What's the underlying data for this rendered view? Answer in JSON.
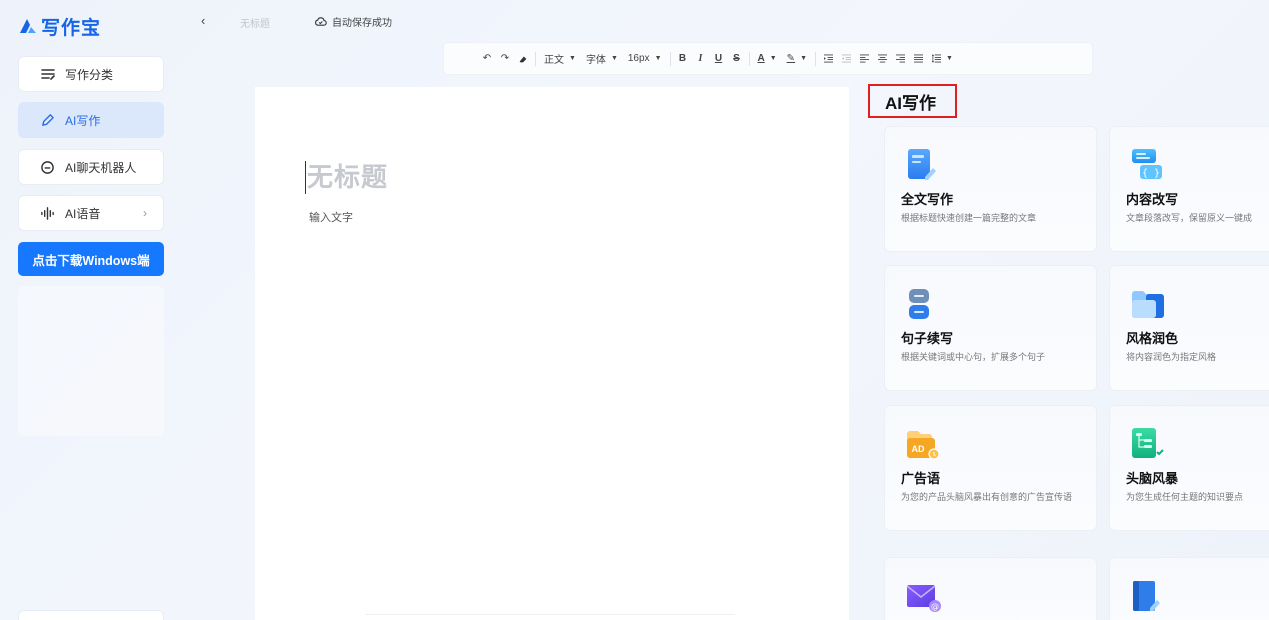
{
  "app": {
    "name": "写作宝"
  },
  "sidebar": {
    "items": [
      {
        "label": "写作分类",
        "icon": "category-list-icon"
      },
      {
        "label": "AI写作",
        "icon": "pen-icon",
        "active": true
      },
      {
        "label": "AI聊天机器人",
        "icon": "chat-bubble-icon"
      },
      {
        "label": "AI语音",
        "icon": "audio-wave-icon",
        "chevron": "›"
      }
    ],
    "download_label": "点击下载Windows端"
  },
  "topbar": {
    "back_glyph": "‹",
    "doc_name": "无标题",
    "save_status": "自动保存成功"
  },
  "toolbar": {
    "undo": "↶",
    "redo": "↷",
    "clear_format": "⌫",
    "paragraph": "正文",
    "font": "字体",
    "font_size": "16px",
    "bold": "B",
    "italic": "I",
    "underline": "U",
    "strike": "S",
    "font_color": "A",
    "highlight": "✎",
    "caret": "▼"
  },
  "editor": {
    "title_placeholder": "无标题",
    "body_placeholder": "输入文字"
  },
  "ai_panel": {
    "title": "AI写作",
    "cards": [
      {
        "title": "全文写作",
        "desc": "根据标题快速创建一篇完整的文章",
        "icon": "document-pen-icon"
      },
      {
        "title": "内容改写",
        "desc": "文章段落改写，保留原义一键成",
        "icon": "rewrite-icon"
      },
      {
        "title": "句子续写",
        "desc": "根据关键词或中心句，扩展多个句子",
        "icon": "sentence-continue-icon"
      },
      {
        "title": "风格润色",
        "desc": "将内容润色为指定风格",
        "icon": "folder-style-icon"
      },
      {
        "title": "广告语",
        "desc": "为您的产品头脑风暴出有创意的广告宣传语",
        "icon": "ad-icon"
      },
      {
        "title": "头脑风暴",
        "desc": "为您生成任何主题的知识要点",
        "icon": "mindmap-icon"
      },
      {
        "title": "",
        "desc": "",
        "icon": "email-icon"
      },
      {
        "title": "",
        "desc": "",
        "icon": "book-icon"
      }
    ]
  },
  "colors": {
    "brand": "#1565e8",
    "download_button": "#1677ff",
    "active_item_bg": "#dbe7fb",
    "highlight_border": "#e02020"
  }
}
